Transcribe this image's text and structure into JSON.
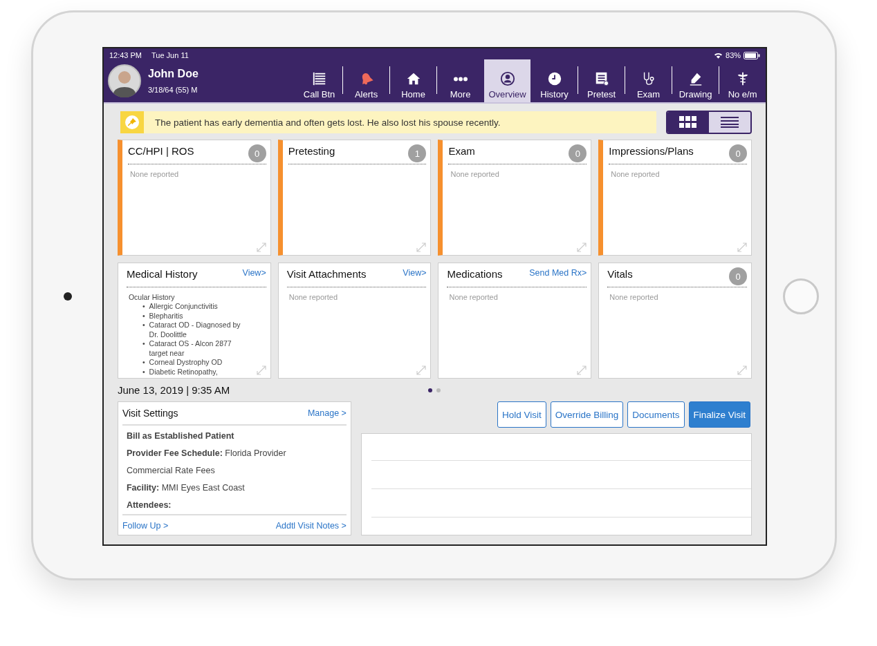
{
  "status_bar": {
    "time": "12:43 PM",
    "date": "Tue Jun 11",
    "battery": "83%"
  },
  "patient": {
    "name": "John Doe",
    "details": "3/18/64 (55) M"
  },
  "nav": [
    {
      "label": "Call Btn",
      "selected": false
    },
    {
      "label": "Alerts",
      "selected": false
    },
    {
      "label": "Home",
      "selected": false
    },
    {
      "label": "More",
      "selected": false
    },
    {
      "label": "Overview",
      "selected": true
    },
    {
      "label": "History",
      "selected": false
    },
    {
      "label": "Pretest",
      "selected": false
    },
    {
      "label": "Exam",
      "selected": false
    },
    {
      "label": "Drawing",
      "selected": false
    },
    {
      "label": "No e/m",
      "selected": false
    }
  ],
  "alert": {
    "text": "The patient has early dementia and often gets lost.  He also lost his spouse recently."
  },
  "view_toggle": [
    {
      "kind": "grid",
      "selected": false
    },
    {
      "kind": "list",
      "selected": true
    }
  ],
  "cards": [
    {
      "title": "CC/HPI | ROS",
      "flagged": true,
      "count": "0",
      "body": "None reported"
    },
    {
      "title": "Pretesting",
      "flagged": true,
      "count": "1"
    },
    {
      "title": "Exam",
      "flagged": true,
      "count": "0",
      "body": "None reported"
    },
    {
      "title": "Impressions/Plans",
      "flagged": true,
      "count": "0",
      "body": "None reported"
    },
    {
      "title": "Medical History",
      "flagged": false,
      "link": "View>",
      "list": [
        {
          "label": "Ocular History",
          "children": [
            {
              "marker": "•",
              "label": "Allergic Conjunctivitis"
            },
            {
              "marker": "•",
              "label": "Blepharitis"
            },
            {
              "marker": "•",
              "label": "Cataract OD - Diagnosed by Dr. Doolittle"
            },
            {
              "marker": "•",
              "label": "Cataract OS - Alcon 2877 target near"
            },
            {
              "marker": "•",
              "label": "Corneal Dystrophy OD"
            },
            {
              "marker": "•",
              "label": "Diabetic Retinopathy,"
            }
          ]
        }
      ]
    },
    {
      "title": "Visit Attachments",
      "flagged": false,
      "link": "View>",
      "body": "None reported"
    },
    {
      "title": "Medications",
      "flagged": false,
      "link": "Send Med Rx>",
      "body": "None reported"
    },
    {
      "title": "Vitals",
      "flagged": false,
      "count": "0",
      "body": "None reported"
    }
  ],
  "pager": [
    {
      "selected": true
    },
    {
      "selected": false
    }
  ],
  "visit_date": "June 13, 2019 | 9:35 AM",
  "visit_settings": {
    "title": "Visit Settings",
    "link": "Manage >",
    "lines": [
      "**Bill as Established Patient**",
      "**Provider Fee Schedule:** Florida Provider",
      "Commercial Rate Fees",
      "**Facility:** MMI Eyes East Coast",
      "**Attendees:**"
    ],
    "footer_left": "Follow Up >",
    "footer_right": "Addtl Visit Notes >"
  },
  "actions": [
    {
      "label": "Hold Visit",
      "primary": false
    },
    {
      "label": "Override Billing",
      "primary": false
    },
    {
      "label": "Documents",
      "primary": false
    },
    {
      "label": "Finalize Visit",
      "primary": true
    }
  ]
}
